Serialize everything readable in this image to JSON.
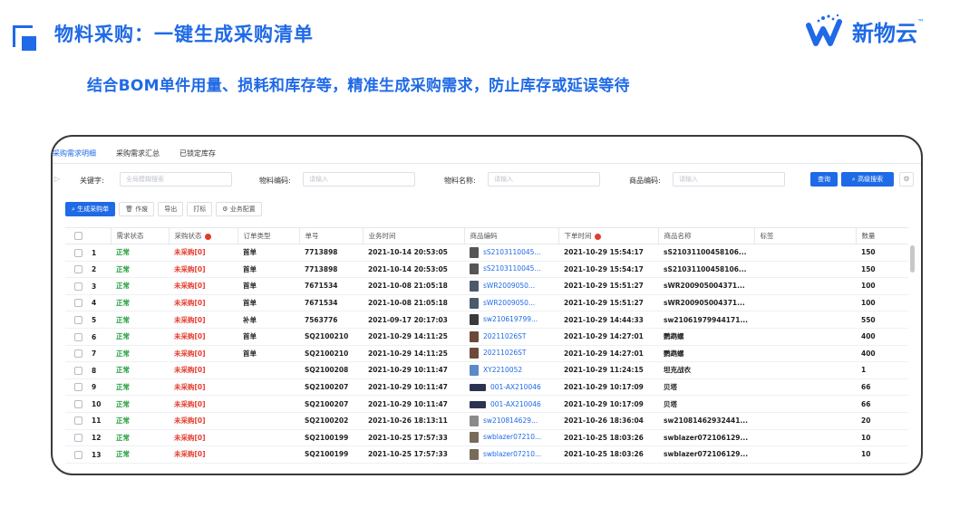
{
  "header": {
    "title": "物料采购：一键生成采购清单",
    "subtitle": "结合BOM单件用量、损耗和库存等，精准生成采购需求，防止库存或延误等待",
    "brand_name": "新物云",
    "brand_tm": "™",
    "accent_color": "#1f6ae6"
  },
  "tabs": [
    {
      "label": "采购需求明细",
      "active": true
    },
    {
      "label": "采购需求汇总",
      "active": false
    },
    {
      "label": "已锁定库存",
      "active": false
    }
  ],
  "filter": {
    "keyword_label": "关键字:",
    "keyword_placeholder": "全局模糊搜索",
    "material_code_label": "物料编码:",
    "material_code_placeholder": "请输入",
    "material_name_label": "物料名称:",
    "material_name_placeholder": "请输入",
    "product_code_label": "商品编码:",
    "product_code_placeholder": "请输入",
    "query_label": "查询",
    "advanced_label": "高级搜索"
  },
  "toolbar": {
    "generate_label": "生成采购单",
    "void_label": "作废",
    "export_label": "导出",
    "print_label": "打标",
    "config_label": "业务配置"
  },
  "table": {
    "columns": [
      "需求状态",
      "采购状态",
      "订单类型",
      "单号",
      "业务时间",
      "商品编码",
      "下单时间",
      "商品名称",
      "标签",
      "数量"
    ],
    "rows": [
      {
        "no": "1",
        "demand": "正常",
        "purchase": "未采购[0]",
        "type": "首单",
        "order": "7713898",
        "biz_time": "2021-10-14 20:53:05",
        "code": "sS2103110045...",
        "order_time": "2021-10-29 15:54:17",
        "name": "sS21031100458106...",
        "tag": "",
        "qty": "150",
        "thumb": "#555555"
      },
      {
        "no": "2",
        "demand": "正常",
        "purchase": "未采购[0]",
        "type": "首单",
        "order": "7713898",
        "biz_time": "2021-10-14 20:53:05",
        "code": "sS2103110045...",
        "order_time": "2021-10-29 15:54:17",
        "name": "sS21031100458106...",
        "tag": "",
        "qty": "150",
        "thumb": "#555555"
      },
      {
        "no": "3",
        "demand": "正常",
        "purchase": "未采购[0]",
        "type": "首单",
        "order": "7671534",
        "biz_time": "2021-10-08 21:05:18",
        "code": "sWR2009050...",
        "order_time": "2021-10-29 15:51:27",
        "name": "sWR200905004371...",
        "tag": "",
        "qty": "100",
        "thumb": "#4a5a6a"
      },
      {
        "no": "4",
        "demand": "正常",
        "purchase": "未采购[0]",
        "type": "首单",
        "order": "7671534",
        "biz_time": "2021-10-08 21:05:18",
        "code": "sWR2009050...",
        "order_time": "2021-10-29 15:51:27",
        "name": "sWR200905004371...",
        "tag": "",
        "qty": "100",
        "thumb": "#4a5a6a"
      },
      {
        "no": "5",
        "demand": "正常",
        "purchase": "未采购[0]",
        "type": "补单",
        "order": "7563776",
        "biz_time": "2021-09-17 20:17:03",
        "code": "sw210619799...",
        "order_time": "2021-10-29 14:44:33",
        "name": "sw21061979944171...",
        "tag": "",
        "qty": "550",
        "thumb": "#3a3a3a"
      },
      {
        "no": "6",
        "demand": "正常",
        "purchase": "未采购[0]",
        "type": "首单",
        "order": "SQ2100210",
        "biz_time": "2021-10-29 14:11:25",
        "code": "20211026ST",
        "order_time": "2021-10-29 14:27:01",
        "name": "鹦鹉螺",
        "tag": "",
        "qty": "400",
        "thumb": "#6b4a3a"
      },
      {
        "no": "7",
        "demand": "正常",
        "purchase": "未采购[0]",
        "type": "首单",
        "order": "SQ2100210",
        "biz_time": "2021-10-29 14:11:25",
        "code": "20211026ST",
        "order_time": "2021-10-29 14:27:01",
        "name": "鹦鹉螺",
        "tag": "",
        "qty": "400",
        "thumb": "#6b4a3a"
      },
      {
        "no": "8",
        "demand": "正常",
        "purchase": "未采购[0]",
        "type": "",
        "order": "SQ2100208",
        "biz_time": "2021-10-29 10:11:47",
        "code": "XY2210052",
        "order_time": "2021-10-29 11:24:15",
        "name": "坦克战衣",
        "tag": "",
        "qty": "1",
        "thumb": "#5a8ac8"
      },
      {
        "no": "9",
        "demand": "正常",
        "purchase": "未采购[0]",
        "type": "",
        "order": "SQ2100207",
        "biz_time": "2021-10-29 10:11:47",
        "code": "001-AX210046",
        "order_time": "2021-10-29 10:17:09",
        "name": "贝塔",
        "tag": "",
        "qty": "66",
        "thumb": "#2a3450",
        "wide": true
      },
      {
        "no": "10",
        "demand": "正常",
        "purchase": "未采购[0]",
        "type": "",
        "order": "SQ2100207",
        "biz_time": "2021-10-29 10:11:47",
        "code": "001-AX210046",
        "order_time": "2021-10-29 10:17:09",
        "name": "贝塔",
        "tag": "",
        "qty": "66",
        "thumb": "#2a3450",
        "wide": true
      },
      {
        "no": "11",
        "demand": "正常",
        "purchase": "未采购[0]",
        "type": "",
        "order": "SQ2100202",
        "biz_time": "2021-10-26 18:13:11",
        "code": "sw210814629...",
        "order_time": "2021-10-26 18:36:04",
        "name": "sw21081462932441...",
        "tag": "",
        "qty": "20",
        "thumb": "#8a8a8a"
      },
      {
        "no": "12",
        "demand": "正常",
        "purchase": "未采购[0]",
        "type": "",
        "order": "SQ2100199",
        "biz_time": "2021-10-25 17:57:33",
        "code": "swblazer07210...",
        "order_time": "2021-10-25 18:03:26",
        "name": "swblazer072106129...",
        "tag": "",
        "qty": "10",
        "thumb": "#7a6a5a"
      },
      {
        "no": "13",
        "demand": "正常",
        "purchase": "未采购[0]",
        "type": "",
        "order": "SQ2100199",
        "biz_time": "2021-10-25 17:57:33",
        "code": "swblazer07210...",
        "order_time": "2021-10-25 18:03:26",
        "name": "swblazer072106129...",
        "tag": "",
        "qty": "10",
        "thumb": "#7a6a5a"
      }
    ]
  }
}
